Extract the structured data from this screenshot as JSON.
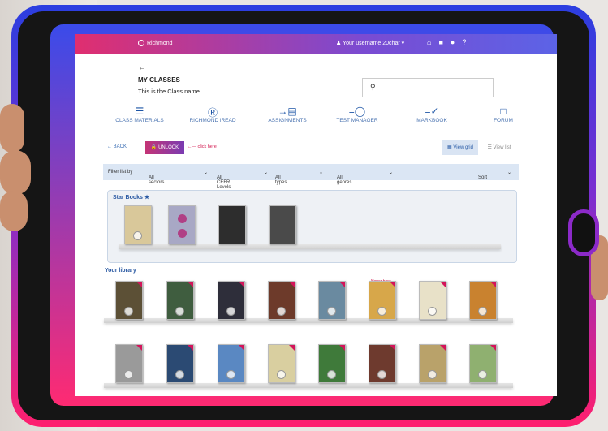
{
  "app": {
    "brand": "Richmond",
    "username": "Your username 20char"
  },
  "header": {
    "title": "MY CLASSES",
    "subtitle": "This is the Class name"
  },
  "nav": [
    {
      "label": "CLASS MATERIALS",
      "icon": "list-icon"
    },
    {
      "label": "RICHMOND iREAD",
      "icon": "r-book-icon"
    },
    {
      "label": "ASSIGNMENTS",
      "icon": "assign-icon"
    },
    {
      "label": "TEST MANAGER",
      "icon": "timer-icon"
    },
    {
      "label": "MARKBOOK",
      "icon": "markbook-icon"
    },
    {
      "label": "FORUM",
      "icon": "chat-icon"
    }
  ],
  "toolbar": {
    "back": "BACK",
    "unlock": "UNLOCK",
    "hint": "click here",
    "view_grid": "View grid",
    "view_list": "View list"
  },
  "filters": {
    "label": "Filter list by",
    "sectors": "All sectors",
    "cefr": "All CEFR Levels",
    "types": "All types",
    "genres": "All genres",
    "sort": "Sort"
  },
  "star_books": {
    "title": "Star Books",
    "books": [
      {
        "color": "#d9c89a"
      },
      {
        "color": "#8fa7b6"
      },
      {
        "color": "#2d2d2d"
      },
      {
        "color": "#4a4a4a"
      }
    ]
  },
  "library": {
    "title": "Your library",
    "new_tag": "Never here",
    "row1": [
      {
        "color": "#5c5036"
      },
      {
        "color": "#3f5d3f"
      },
      {
        "color": "#2e2e3a"
      },
      {
        "color": "#6d3a2a"
      },
      {
        "color": "#6a8aa0"
      },
      {
        "color": "#d7a74a"
      },
      {
        "color": "#e8e1c8"
      },
      {
        "color": "#c9822f"
      }
    ],
    "row2": [
      {
        "color": "#9a9a9a"
      },
      {
        "color": "#2b4a73"
      },
      {
        "color": "#5a88c2"
      },
      {
        "color": "#d9cfa0"
      },
      {
        "color": "#3f7a3a"
      },
      {
        "color": "#6e3a2e"
      },
      {
        "color": "#b9a26a"
      },
      {
        "color": "#8fb070"
      }
    ]
  },
  "colors": {
    "accent": "#2b5aa3",
    "brand_pink": "#e02e6f",
    "brand_purple": "#7a4bd2"
  }
}
